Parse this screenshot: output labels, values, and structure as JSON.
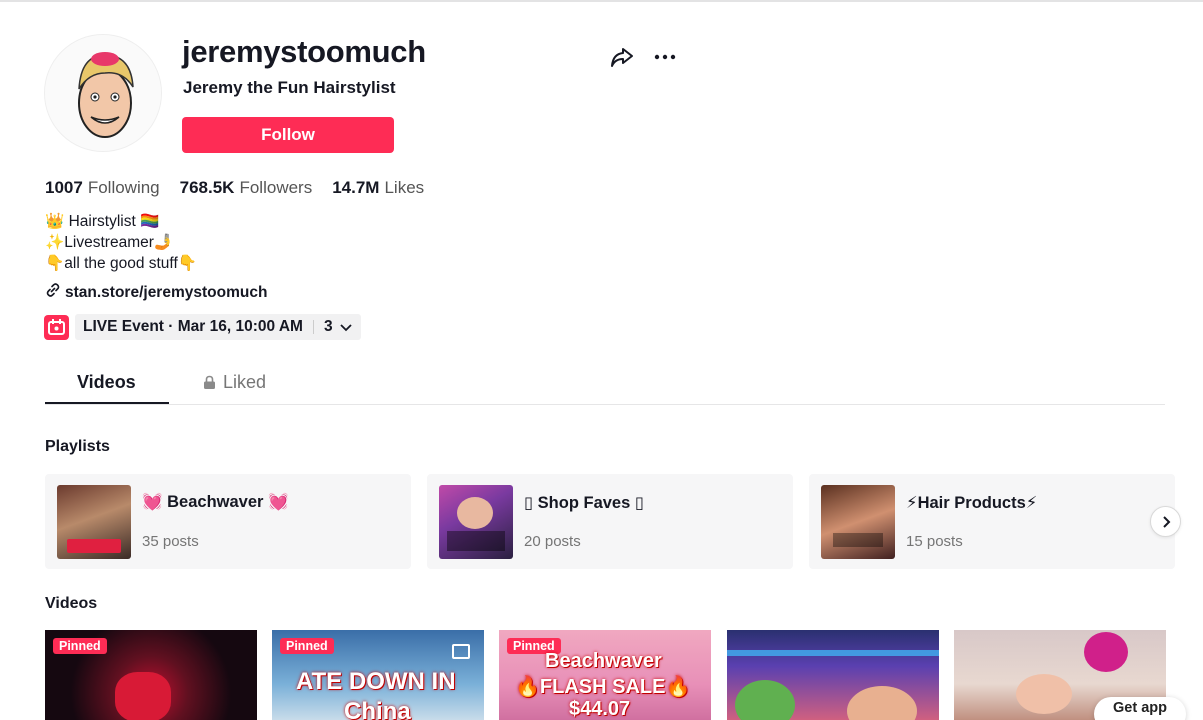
{
  "profile": {
    "username": "jeremystoomuch",
    "nickname": "Jeremy the Fun Hairstylist",
    "follow_label": "Follow"
  },
  "stats": {
    "following_count": "1007",
    "following_label": "Following",
    "followers_count": "768.5K",
    "followers_label": "Followers",
    "likes_count": "14.7M",
    "likes_label": "Likes"
  },
  "bio": {
    "line1": "👑 Hairstylist 🏳️‍🌈",
    "line2": "✨Livestreamer🤳",
    "line3": "👇all the good stuff👇",
    "link": "stan.store/jeremystoomuch"
  },
  "event": {
    "label": "LIVE Event · Mar 16, 10:00 AM",
    "count": "3"
  },
  "tabs": {
    "videos": "Videos",
    "liked": "Liked"
  },
  "sections": {
    "playlists": "Playlists",
    "videos": "Videos"
  },
  "playlists": [
    {
      "title": "💓 Beachwaver 💓",
      "count": "35 posts"
    },
    {
      "title": "▯ Shop Faves ▯",
      "count": "20 posts"
    },
    {
      "title": "⚡Hair Products⚡",
      "count": "15 posts"
    }
  ],
  "videos": [
    {
      "pinned": "Pinned",
      "overlay": ""
    },
    {
      "pinned": "Pinned",
      "overlay": "ATE DOWN IN",
      "overlay2": "China"
    },
    {
      "pinned": "Pinned",
      "overlay": "Beachwaver",
      "overlay2": "🔥FLASH SALE🔥",
      "overlay3": "$44.07"
    },
    {
      "pinned": "",
      "overlay": ""
    },
    {
      "pinned": "",
      "overlay": ""
    }
  ],
  "get_app": "Get app",
  "colors": {
    "accent": "#fe2c55",
    "text": "#161823"
  }
}
